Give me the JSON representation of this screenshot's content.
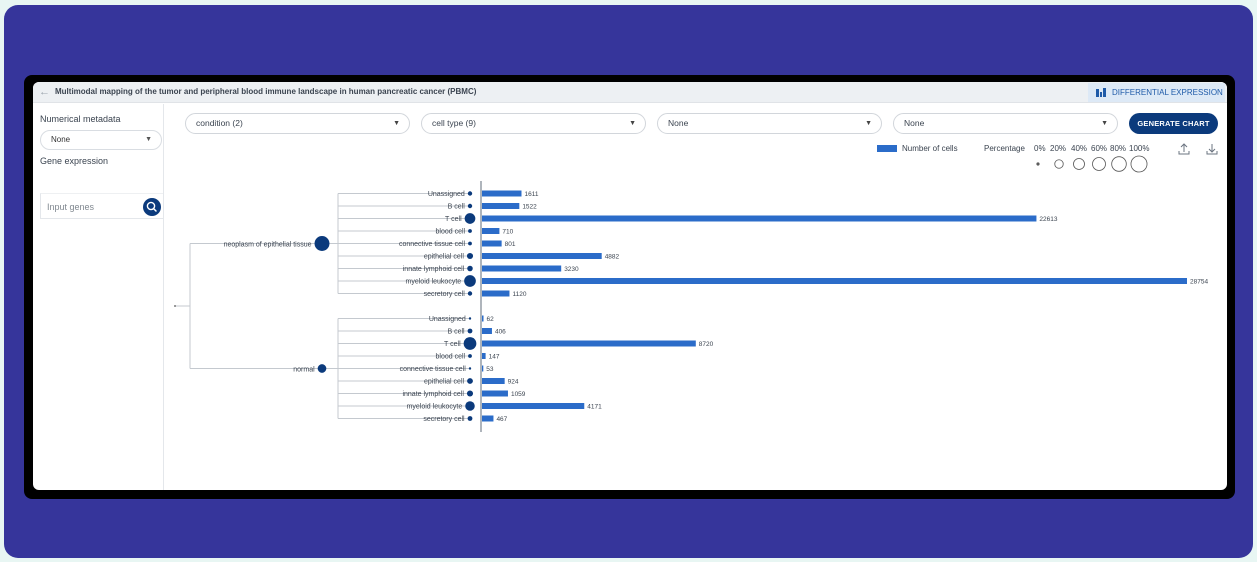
{
  "header": {
    "back_icon": "arrow-left-icon",
    "title": "Multimodal mapping of the tumor and peripheral blood immune landscape in human pancreatic cancer (PBMC)",
    "diff_button_label": "DIFFERENTIAL EXPRESSION",
    "diff_button_icon": "differential-expression-icon"
  },
  "sidebar": {
    "numerical_label": "Numerical metadata",
    "numerical_value": "None",
    "gene_label": "Gene expression",
    "gene_placeholder": "Input genes",
    "search_icon": "search-icon"
  },
  "toolbar": {
    "select1": "condition (2)",
    "select2": "cell type (9)",
    "select3": "None",
    "select4": "None",
    "generate_label": "GENERATE CHART"
  },
  "legend": {
    "number_label": "Number of cells",
    "percentage_label": "Percentage",
    "pct_steps": [
      "0%",
      "20%",
      "40%",
      "60%",
      "80%",
      "100%"
    ],
    "upload_icon": "upload-icon",
    "download_icon": "download-icon"
  },
  "colors": {
    "bar": "#2b6cc9",
    "node": "#0b3a7c",
    "accent": "#0b3a7c",
    "frame": "#36359b"
  },
  "chart_data": {
    "type": "bar",
    "orientation": "horizontal",
    "groups": [
      {
        "name": "neoplasm of epithelial tissue",
        "categories": [
          "Unassigned",
          "B cell",
          "T cell",
          "blood cell",
          "connective tissue cell",
          "epithelial cell",
          "innate lymphoid cell",
          "myeloid leukocyte",
          "secretory cell"
        ],
        "values": [
          1611,
          1522,
          22613,
          710,
          801,
          4882,
          3230,
          28754,
          1120
        ],
        "percent": [
          0.02,
          0.02,
          0.35,
          0.01,
          0.01,
          0.07,
          0.05,
          0.44,
          0.02
        ]
      },
      {
        "name": "normal",
        "categories": [
          "Unassigned",
          "B cell",
          "T cell",
          "blood cell",
          "connective tissue cell",
          "epithelial cell",
          "innate lymphoid cell",
          "myeloid leukocyte",
          "secretory cell"
        ],
        "values": [
          62,
          406,
          8720,
          147,
          53,
          924,
          1059,
          4171,
          467
        ],
        "percent": [
          0.0,
          0.03,
          0.54,
          0.01,
          0.0,
          0.06,
          0.07,
          0.26,
          0.03
        ]
      }
    ],
    "group_percent": [
      0.8,
      0.2
    ],
    "xlim": [
      0,
      28754
    ],
    "legend": "top-right"
  }
}
